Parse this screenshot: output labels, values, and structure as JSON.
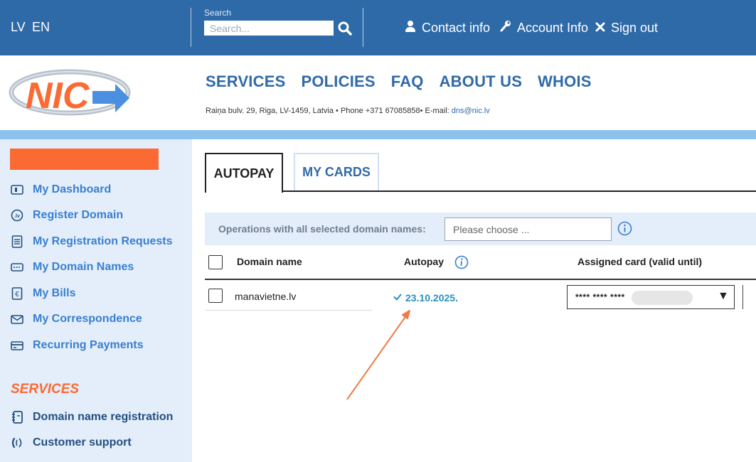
{
  "topbar": {
    "lang_lv": "LV",
    "lang_en": "EN",
    "search_label": "Search",
    "search_placeholder": "Search...",
    "contact_info": "Contact info",
    "account_info": "Account Info",
    "sign_out": "Sign out"
  },
  "logo": {
    "text": "NIC"
  },
  "mainnav": [
    "SERVICES",
    "POLICIES",
    "FAQ",
    "ABOUT US",
    "WHOIS"
  ],
  "address": {
    "text": "Raiņa bulv. 29, Riga, LV-1459, Latvia • Phone +371 67085858• E-mail: ",
    "email": "dns@nic.lv"
  },
  "sidebar": {
    "items": [
      {
        "label": "My Dashboard",
        "icon": "dashboard-icon"
      },
      {
        "label": "Register Domain",
        "icon": "register-domain-icon"
      },
      {
        "label": "My Registration Requests",
        "icon": "requests-icon"
      },
      {
        "label": "My Domain Names",
        "icon": "domain-names-icon"
      },
      {
        "label": "My Bills",
        "icon": "bills-icon"
      },
      {
        "label": "My Correspondence",
        "icon": "envelope-icon"
      },
      {
        "label": "Recurring Payments",
        "icon": "card-icon"
      }
    ],
    "services_heading": "SERVICES",
    "services_items": [
      {
        "label": "Domain name registration",
        "icon": "notebook-icon"
      },
      {
        "label": "Customer support",
        "icon": "support-icon"
      }
    ]
  },
  "tabs": {
    "autopay": "AUTOPAY",
    "my_cards": "MY CARDS"
  },
  "operations": {
    "label": "Operations with all selected domain names:",
    "placeholder": "Please choose ..."
  },
  "table": {
    "headers": {
      "domain": "Domain name",
      "autopay": "Autopay",
      "card": "Assigned card (valid until)"
    },
    "rows": [
      {
        "domain": "manavietne.lv",
        "autopay_date": "23.10.2025.",
        "card_mask": "**** **** ****"
      }
    ]
  },
  "colors": {
    "brand_blue": "#2f6aa8",
    "accent_orange": "#fc6a33",
    "sidebar_bg": "#e3eefa"
  }
}
